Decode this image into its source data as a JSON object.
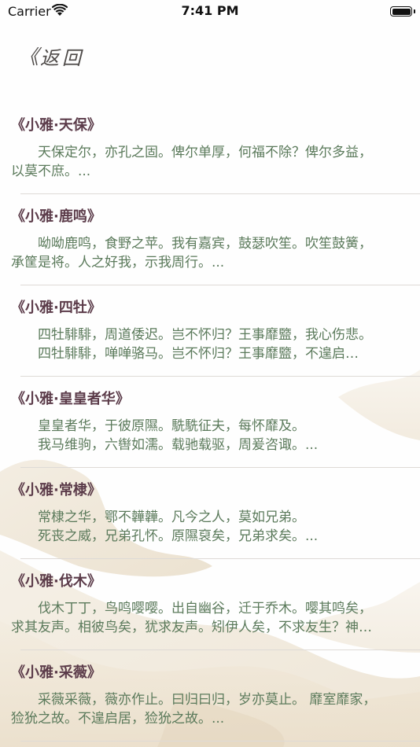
{
  "status_bar": {
    "carrier": "Carrier",
    "time": "7:41 PM",
    "battery_level": 1.0
  },
  "nav": {
    "back_chevron": "《",
    "back_label": "返回"
  },
  "colors": {
    "title": "#5b3b49",
    "excerpt": "#5b7a5b",
    "divider": "#dedad6",
    "back": "#4e4a48"
  },
  "poems": [
    {
      "title": "《小雅·天保》",
      "lines": [
        "　　天保定尔，亦孔之固。俾尔单厚，何福不除？俾尔多益，",
        "以莫不庶。..."
      ]
    },
    {
      "title": "《小雅·鹿鸣》",
      "lines": [
        "　　呦呦鹿鸣，食野之苹。我有嘉宾，鼓瑟吹笙。吹笙鼓簧，",
        "承筐是将。人之好我，示我周行。..."
      ]
    },
    {
      "title": "《小雅·四牡》",
      "lines": [
        "　　四牡騑騑，周道倭迟。岂不怀归？王事靡盬，我心伤悲。",
        "　　四牡騑騑，啴啴骆马。岂不怀归？王事靡盬，不遑启…"
      ]
    },
    {
      "title": "《小雅·皇皇者华》",
      "lines": [
        "　　皇皇者华，于彼原隰。駪駪征夫，每怀靡及。",
        "　　我马维驹，六辔如濡。载驰载驱，周爰咨诹。..."
      ]
    },
    {
      "title": "《小雅·常棣》",
      "lines": [
        "　　常棣之华，鄂不韡韡。凡今之人，莫如兄弟。",
        "　　死丧之威，兄弟孔怀。原隰裒矣，兄弟求矣。..."
      ]
    },
    {
      "title": "《小雅·伐木》",
      "lines": [
        "　　伐木丁丁，鸟鸣嘤嘤。出自幽谷，迁于乔木。嘤其鸣矣，",
        "求其友声。相彼鸟矣，犹求友声。矧伊人矣，不求友生？神…"
      ]
    },
    {
      "title": "《小雅·采薇》",
      "lines": [
        "　　采薇采薇，薇亦作止。曰归曰归，岁亦莫止。 靡室靡家，",
        "猃狁之故。不遑启居，猃狁之故。..."
      ]
    }
  ]
}
